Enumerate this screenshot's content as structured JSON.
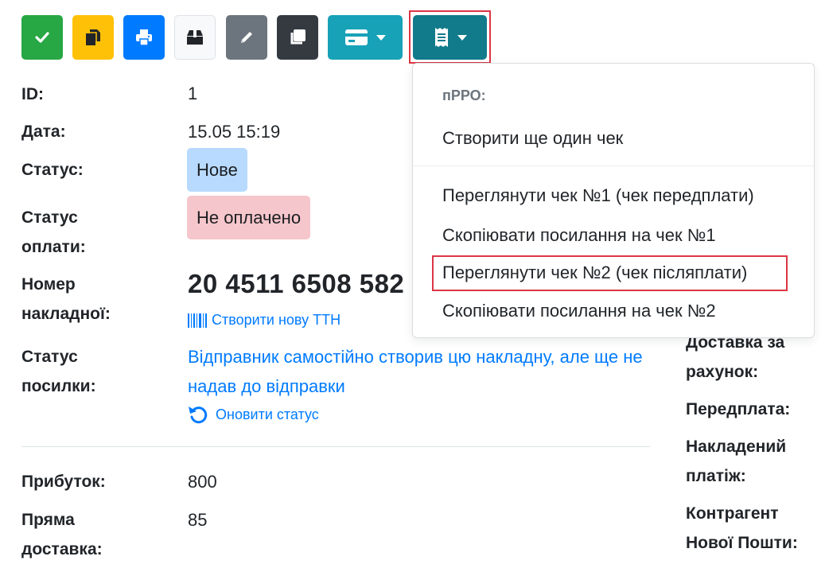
{
  "toolbar": {
    "buttons": [
      {
        "icon": "check-icon",
        "color": "#28a745"
      },
      {
        "icon": "copy-icon",
        "color": "#ffc107"
      },
      {
        "icon": "print-icon",
        "color": "#007bff"
      },
      {
        "icon": "box-icon",
        "color": "#f8f9fa"
      },
      {
        "icon": "pencil-icon",
        "color": "#6c757d"
      },
      {
        "icon": "duplicate-icon",
        "color": "#343a40"
      },
      {
        "icon": "credit-card-icon",
        "color": "#17a2b8"
      },
      {
        "icon": "receipt-icon",
        "color": "#117a8b"
      }
    ]
  },
  "order": {
    "id_label": "ID:",
    "id_value": "1",
    "date_label": "Дата:",
    "date_value": "15.05 15:19",
    "status_label": "Статус:",
    "status_value": "Нове",
    "payment_status_label_1": "Статус",
    "payment_status_label_2": "оплати:",
    "payment_status_value": "Не оплачено",
    "waybill_label_1": "Номер",
    "waybill_label_2": "накладної:",
    "waybill_number": "20 4511 6508 582",
    "create_ttn_link": "Створити нову ТТН",
    "parcel_status_label_1": "Статус",
    "parcel_status_label_2": "посилки:",
    "parcel_status_text": "Відправник самостійно створив цю накладну, але ще не надав до відправки",
    "refresh_status_link": "Оновити статус",
    "profit_label": "Прибуток:",
    "profit_value": "800",
    "direct_delivery_label_1": "Пряма",
    "direct_delivery_label_2": "доставка:",
    "direct_delivery_value": "85"
  },
  "right_column": {
    "delivery_account_1": "Доставка за",
    "delivery_account_2": "рахунок:",
    "prepayment": "Передплата:",
    "cod_1": "Накладений",
    "cod_2": "платіж:",
    "counterparty_1": "Контрагент",
    "counterparty_2": "Нової Пошти:"
  },
  "dropdown": {
    "header": "пРРО:",
    "items": [
      "Створити ще один чек",
      "Переглянути чек №1 (чек передплати)",
      "Скопіювати посилання на чек №1",
      "Переглянути чек №2 (чек післяплати)",
      "Скопіювати посилання на чек №2"
    ]
  },
  "colors": {
    "highlight": "#dc3545",
    "link": "#007bff"
  }
}
